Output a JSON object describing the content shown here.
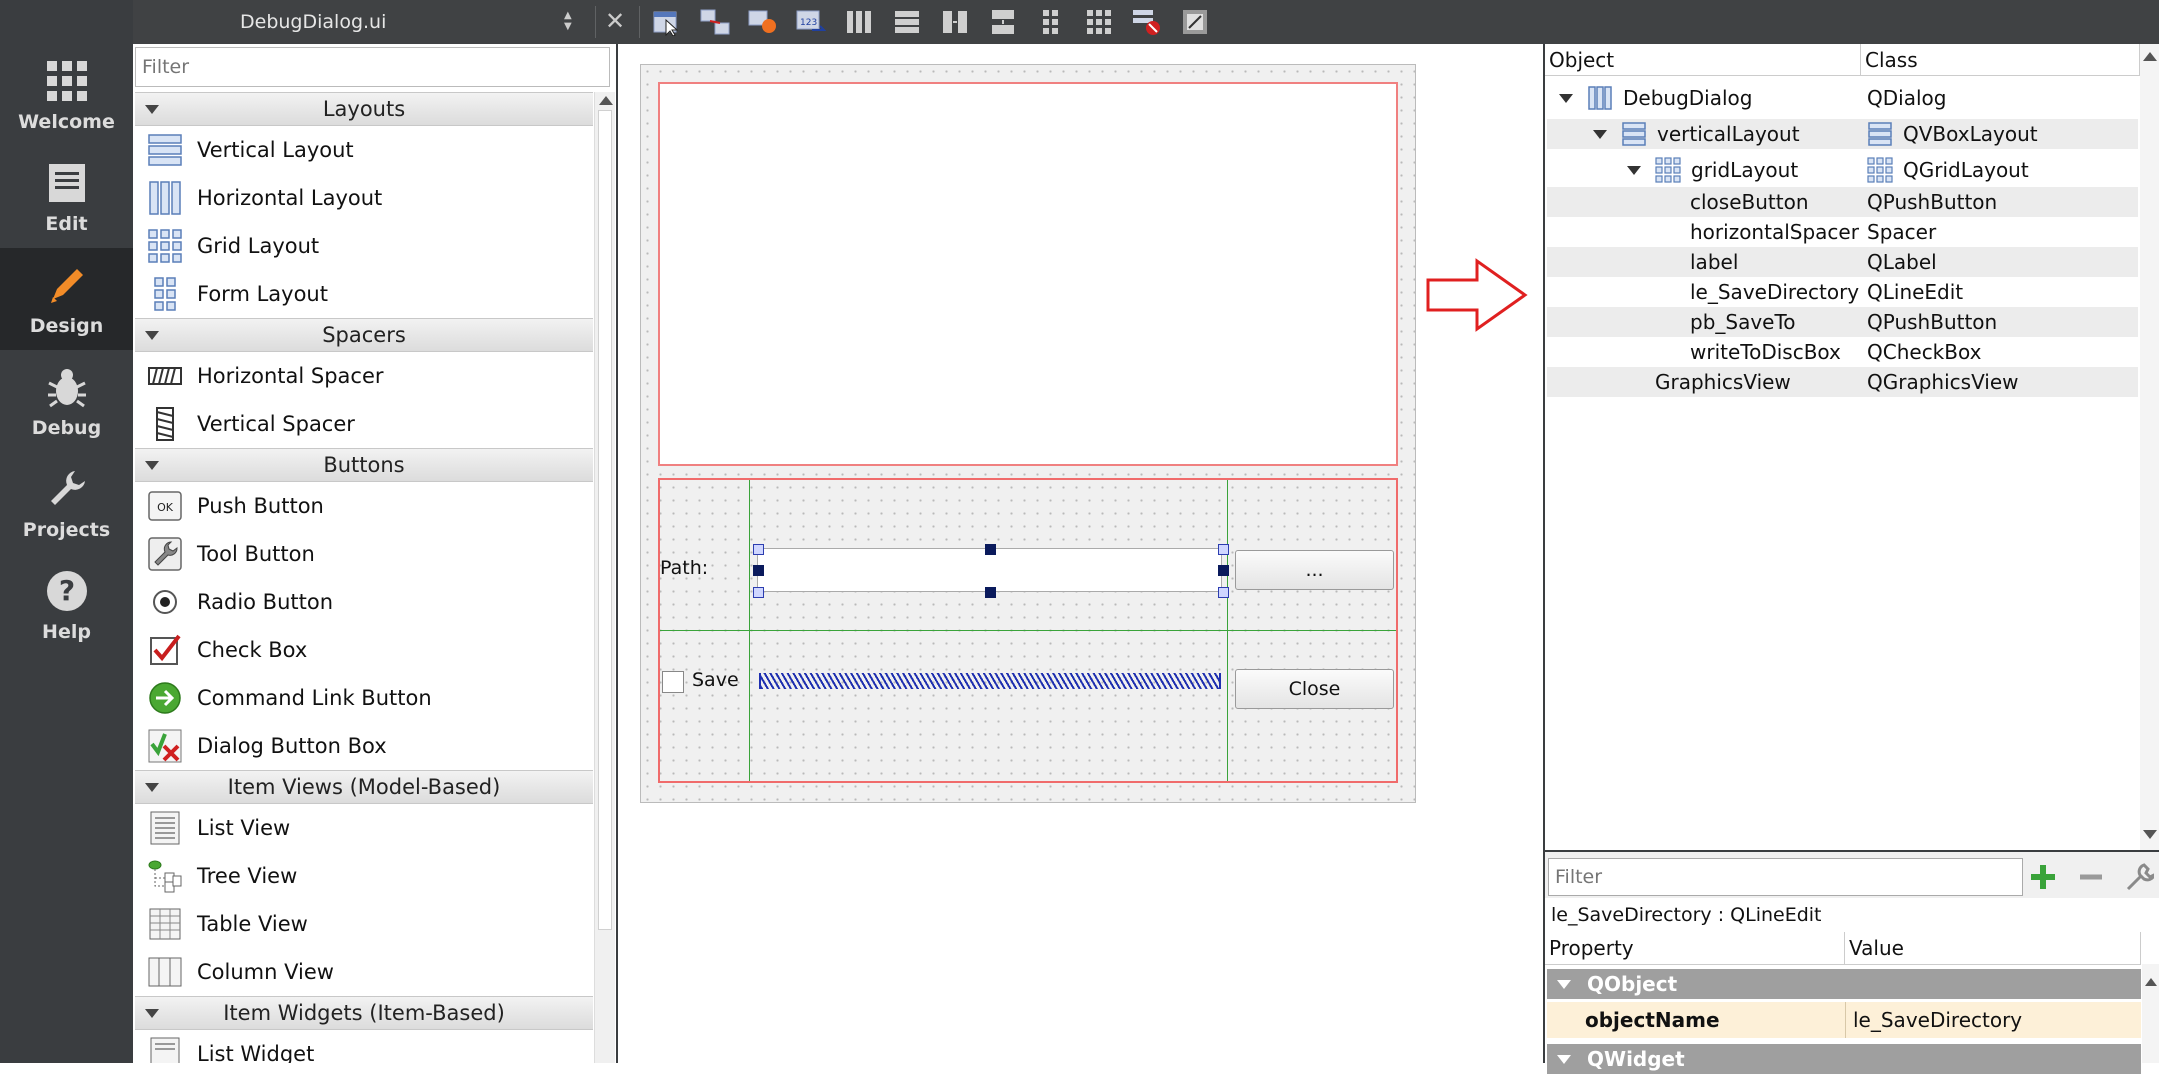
{
  "modes": [
    {
      "label": "Welcome",
      "icon": "welcome-grid-icon",
      "active": false
    },
    {
      "label": "Edit",
      "icon": "edit-document-icon",
      "active": false
    },
    {
      "label": "Design",
      "icon": "design-pencil-icon",
      "active": true
    },
    {
      "label": "Debug",
      "icon": "debug-bug-icon",
      "active": false
    },
    {
      "label": "Projects",
      "icon": "projects-wrench-icon",
      "active": false
    },
    {
      "label": "Help",
      "icon": "help-question-icon",
      "active": false
    }
  ],
  "toolbar": {
    "file_name": "DebugDialog.ui",
    "tools": [
      "edit-widgets-icon",
      "edit-signals-slots-icon",
      "edit-buddies-icon",
      "edit-tab-order-icon",
      "lay-out-horizontally-icon",
      "lay-out-vertically-icon",
      "lay-out-horizontal-splitter-icon",
      "lay-out-vertical-splitter-icon",
      "lay-out-form-icon",
      "lay-out-grid-icon",
      "break-layout-icon",
      "adjust-size-icon"
    ]
  },
  "widget_box": {
    "filter_placeholder": "Filter",
    "categories": [
      {
        "name": "Layouts",
        "items": [
          {
            "label": "Vertical Layout",
            "icon": "vertical-layout-icon"
          },
          {
            "label": "Horizontal Layout",
            "icon": "horizontal-layout-icon"
          },
          {
            "label": "Grid Layout",
            "icon": "grid-layout-icon"
          },
          {
            "label": "Form Layout",
            "icon": "form-layout-icon"
          }
        ]
      },
      {
        "name": "Spacers",
        "items": [
          {
            "label": "Horizontal Spacer",
            "icon": "horizontal-spacer-icon"
          },
          {
            "label": "Vertical Spacer",
            "icon": "vertical-spacer-icon"
          }
        ]
      },
      {
        "name": "Buttons",
        "items": [
          {
            "label": "Push Button",
            "icon": "push-button-icon"
          },
          {
            "label": "Tool Button",
            "icon": "tool-button-icon"
          },
          {
            "label": "Radio Button",
            "icon": "radio-button-icon"
          },
          {
            "label": "Check Box",
            "icon": "check-box-icon"
          },
          {
            "label": "Command Link Button",
            "icon": "command-link-icon"
          },
          {
            "label": "Dialog Button Box",
            "icon": "dialog-button-box-icon"
          }
        ]
      },
      {
        "name": "Item Views (Model-Based)",
        "items": [
          {
            "label": "List View",
            "icon": "list-view-icon"
          },
          {
            "label": "Tree View",
            "icon": "tree-view-icon"
          },
          {
            "label": "Table View",
            "icon": "table-view-icon"
          },
          {
            "label": "Column View",
            "icon": "column-view-icon"
          }
        ]
      },
      {
        "name": "Item Widgets (Item-Based)",
        "items": [
          {
            "label": "List Widget",
            "icon": "list-widget-icon"
          }
        ]
      }
    ]
  },
  "form": {
    "path_label": "Path:",
    "browse_button": "...",
    "save_checkbox_label": "Save",
    "save_checked": false,
    "close_button": "Close"
  },
  "object_inspector": {
    "col_object": "Object",
    "col_class": "Class",
    "rows": [
      {
        "object": "DebugDialog",
        "class": "QDialog",
        "obj_icon": "dialog-layout-icon",
        "class_icon": ""
      },
      {
        "object": "verticalLayout",
        "class": "QVBoxLayout",
        "obj_icon": "vertical-layout-icon",
        "class_icon": "vertical-layout-icon"
      },
      {
        "object": "gridLayout",
        "class": "QGridLayout",
        "obj_icon": "grid-layout-icon",
        "class_icon": "grid-layout-icon"
      },
      {
        "object": "closeButton",
        "class": "QPushButton"
      },
      {
        "object": "horizontalSpacer",
        "class": "Spacer"
      },
      {
        "object": "label",
        "class": "QLabel"
      },
      {
        "object": "le_SaveDirectory",
        "class": "QLineEdit"
      },
      {
        "object": "pb_SaveTo",
        "class": "QPushButton"
      },
      {
        "object": "writeToDiscBox",
        "class": "QCheckBox"
      },
      {
        "object": "GraphicsView",
        "class": "QGraphicsView"
      }
    ]
  },
  "property_editor": {
    "filter_placeholder": "Filter",
    "tools": [
      "add-dynamic-property-icon",
      "remove-dynamic-property-icon",
      "configure-icon"
    ],
    "object_label": "le_SaveDirectory : QLineEdit",
    "col_property": "Property",
    "col_value": "Value",
    "groups": [
      "QObject",
      "QWidget"
    ],
    "rows": [
      {
        "property": "objectName",
        "value": "le_SaveDirectory"
      }
    ]
  },
  "colors": {
    "annotation_arrow": "#e02020",
    "selection_border": "#f06b6b",
    "layout_lines": "#3aa33a",
    "handles": "#0a1a5c",
    "spacer": "#1e2fb0"
  }
}
